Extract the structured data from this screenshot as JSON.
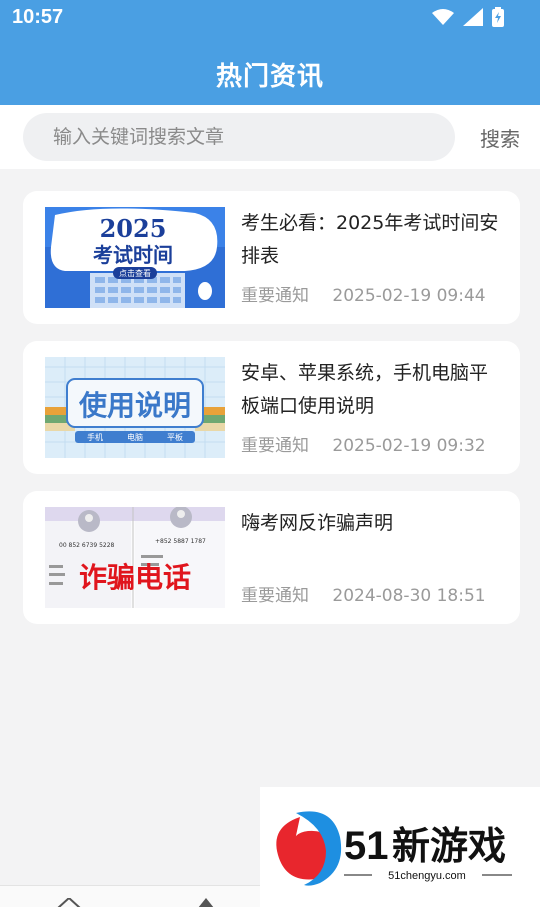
{
  "status_bar": {
    "time": "10:57"
  },
  "header": {
    "title": "热门资讯"
  },
  "search": {
    "placeholder": "输入关键词搜索文章",
    "button_label": "搜索"
  },
  "articles": [
    {
      "title": "考生必看：2025年考试时间安排表",
      "category": "重要通知",
      "date": "2025-02-19 09:44",
      "thumb": {
        "year": "2025",
        "heading": "考试时间",
        "badge": "点击查看"
      }
    },
    {
      "title": "安卓、苹果系统，手机电脑平板端口使用说明",
      "category": "重要通知",
      "date": "2025-02-19 09:32",
      "thumb": {
        "heading": "使用说明",
        "tags": [
          "手机",
          "电脑",
          "平板"
        ]
      }
    },
    {
      "title": "嗨考网反诈骗声明",
      "category": "重要通知",
      "date": "2024-08-30 18:51",
      "thumb": {
        "heading": "诈骗电话",
        "phone_left": "00 852 6739 5228",
        "phone_right": "+852 5887 1787"
      }
    }
  ],
  "watermark": {
    "brand_number": "51",
    "brand_name": "新游戏",
    "url": "51chengyu.com"
  },
  "colors": {
    "header": "#4a9fe3",
    "page_bg": "#f3f3f4",
    "card_bg": "#ffffff"
  }
}
